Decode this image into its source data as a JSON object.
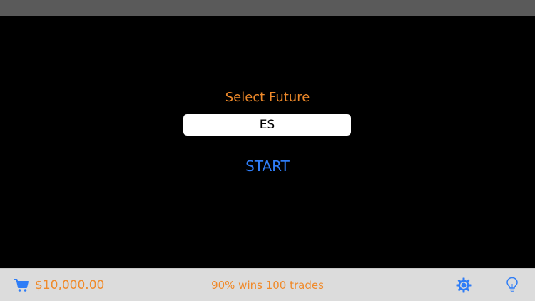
{
  "main": {
    "select_label": "Select Future",
    "future_value": "ES",
    "start_label": "START"
  },
  "bottom_bar": {
    "balance": "$10,000.00",
    "stats": "90% wins 100 trades",
    "icons": {
      "cart": "cart-icon",
      "settings": "gear-icon",
      "tips": "lightbulb-icon"
    }
  },
  "colors": {
    "accent_orange": "#f08a2a",
    "accent_blue": "#2f7df6",
    "background": "#000000",
    "bottom_bar": "#dcdcdc",
    "top_bar": "#5a5a5a"
  }
}
